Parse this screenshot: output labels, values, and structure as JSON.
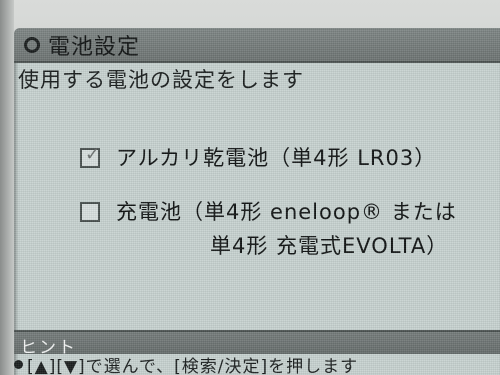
{
  "window": {
    "title": "電池設定"
  },
  "description": "使用する電池の設定をします",
  "options": [
    {
      "label": "アルカリ乾電池（単4形 LR03）",
      "checked": true
    },
    {
      "label": "充電池（単4形 eneloop® または",
      "label_line2": "単4形 充電式EVOLTA）",
      "checked": false
    }
  ],
  "hint": {
    "title": "ヒント",
    "text": "[▲][▼]で選んで、[検索/決定]を押します"
  },
  "icons": {
    "title": "circle-icon",
    "check": "checkmark-icon",
    "bullet": "bullet-icon"
  },
  "colors": {
    "screen_background": "#c7d2d0",
    "title_bar": "#747b7a",
    "bezel": "#c9ccca"
  }
}
